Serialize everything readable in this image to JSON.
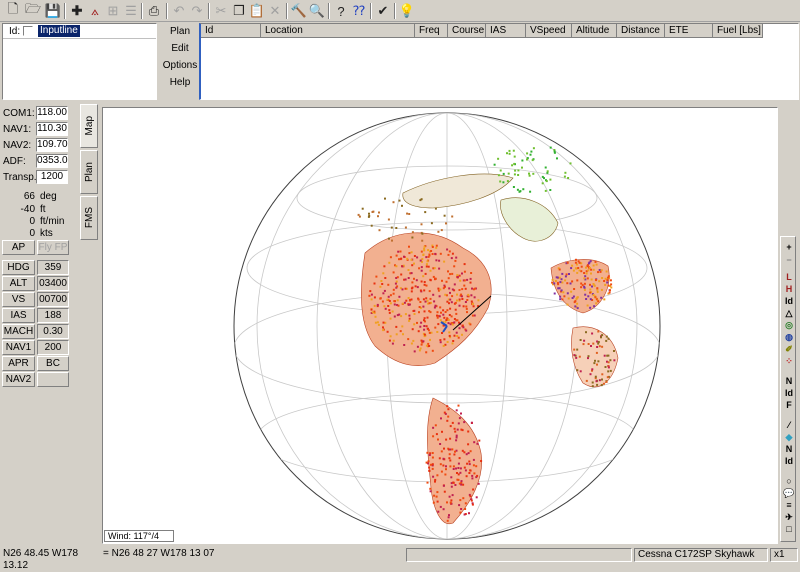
{
  "id_panel": {
    "label": "Id:",
    "input_value": "Inputline"
  },
  "plan_menu": [
    "Plan",
    "Edit",
    "Options",
    "Help"
  ],
  "grid_columns": [
    "Id",
    "Location",
    "Freq",
    "Course",
    "IAS",
    "VSpeed",
    "Altitude",
    "Distance",
    "ETE",
    "Fuel [Lbs]"
  ],
  "radios": [
    {
      "label": "COM1:",
      "value": "118.00"
    },
    {
      "label": "NAV1:",
      "value": "110.30"
    },
    {
      "label": "NAV2:",
      "value": "109.70"
    },
    {
      "label": "ADF:",
      "value": "0353.0"
    },
    {
      "label": "Transp.:",
      "value": "1200"
    }
  ],
  "readouts": [
    {
      "value": "66",
      "unit": "deg"
    },
    {
      "value": "-40",
      "unit": "ft"
    },
    {
      "value": "0",
      "unit": "ft/min"
    },
    {
      "value": "0",
      "unit": "kts"
    }
  ],
  "autopilot": {
    "ap": "AP",
    "fly_fp": "Fly FP",
    "rows": [
      {
        "label": "HDG",
        "value": "359"
      },
      {
        "label": "ALT",
        "value": "03400"
      },
      {
        "label": "VS",
        "value": "00700"
      },
      {
        "label": "IAS",
        "value": "188"
      },
      {
        "label": "MACH",
        "value": "0.30"
      },
      {
        "label": "NAV1",
        "value": "200"
      },
      {
        "label": "APR",
        "value": "BC"
      },
      {
        "label": "NAV2",
        "value": ""
      }
    ]
  },
  "tabs": [
    "Map",
    "Plan",
    "FMS"
  ],
  "wind": "Wind: 117°/4",
  "status": {
    "coord1": "N26 48.45    W178 13.12",
    "coord2": "= N26 48 27    W178 13 07",
    "aircraft": "Cessna C172SP Skyhawk",
    "zoom": "x1"
  },
  "colors": {
    "land": "#f04a10",
    "glacier": "#30b030",
    "ocean": "#ffffff"
  }
}
